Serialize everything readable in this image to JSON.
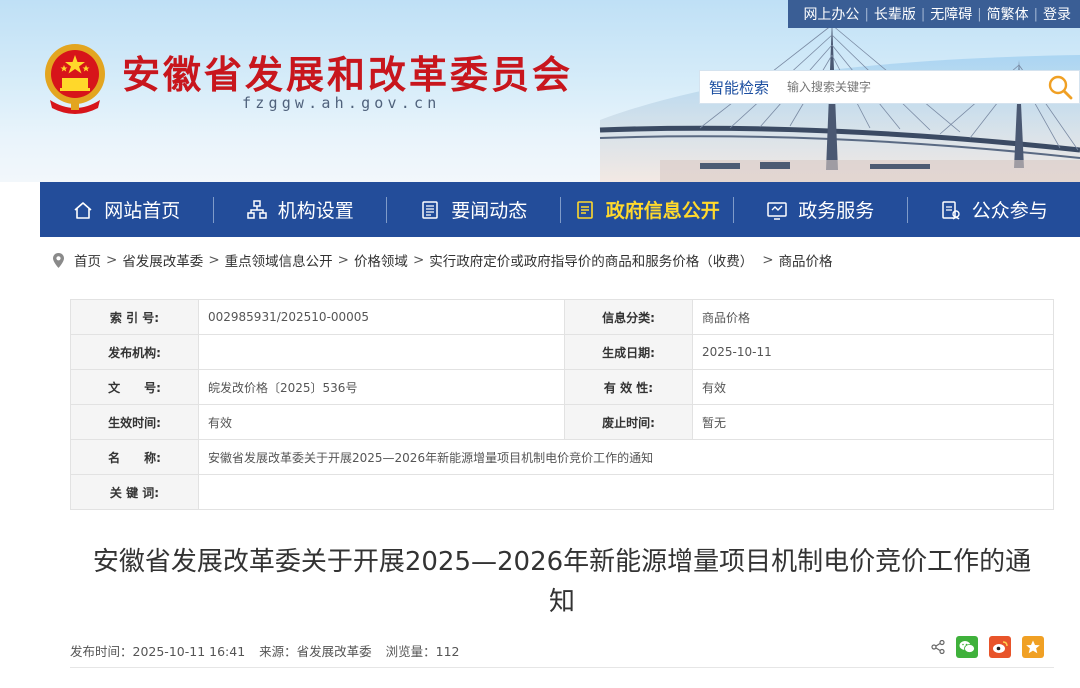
{
  "header": {
    "top_links": [
      "网上办公",
      "长辈版",
      "无障碍",
      "简繁体",
      "登录"
    ],
    "site_title": "安徽省发展和改革委员会",
    "site_domain": "fzggw.ah.gov.cn",
    "search": {
      "label": "智能检索",
      "placeholder": "输入搜索关键字"
    }
  },
  "nav": [
    {
      "label": "网站首页",
      "icon": "home-icon"
    },
    {
      "label": "机构设置",
      "icon": "org-chart-icon"
    },
    {
      "label": "要闻动态",
      "icon": "news-icon"
    },
    {
      "label": "政府信息公开",
      "icon": "info-public-icon",
      "active": true
    },
    {
      "label": "政务服务",
      "icon": "service-icon"
    },
    {
      "label": "公众参与",
      "icon": "participation-icon"
    }
  ],
  "breadcrumb": [
    "首页",
    "省发展改革委",
    "重点领域信息公开",
    "价格领域",
    "实行政府定价或政府指导价的商品和服务价格（收费）",
    "商品价格"
  ],
  "info": {
    "index_label": "索 引 号:",
    "index_value": "002985931/202510-00005",
    "category_label": "信息分类:",
    "category_value": "商品价格",
    "publisher_label": "发布机构:",
    "publisher_value": "",
    "created_label": "生成日期:",
    "created_value": "2025-10-11",
    "docno_label": "文　　号:",
    "docno_value": "皖发改价格〔2025〕536号",
    "validity_label": "有 效 性:",
    "validity_value": "有效",
    "effective_label": "生效时间:",
    "effective_value": "有效",
    "abolish_label": "废止时间:",
    "abolish_value": "暂无",
    "name_label": "名　　称:",
    "name_value": "安徽省发展改革委关于开展2025—2026年新能源增量项目机制电价竞价工作的通知",
    "keywords_label": "关 键 词:",
    "keywords_value": ""
  },
  "article": {
    "title": "安徽省发展改革委关于开展2025—2026年新能源增量项目机制电价竞价工作的通知",
    "publish_time": "发布时间：2025-10-11 16:41",
    "source": "来源：省发展改革委",
    "views": "浏览量：112"
  },
  "colors": {
    "nav_bg": "#234d9a",
    "title_red": "#c8161d",
    "nav_active": "#ffd92c",
    "wechat": "#3fb13b",
    "weibo": "#e8542a",
    "favorite": "#f0a024"
  }
}
